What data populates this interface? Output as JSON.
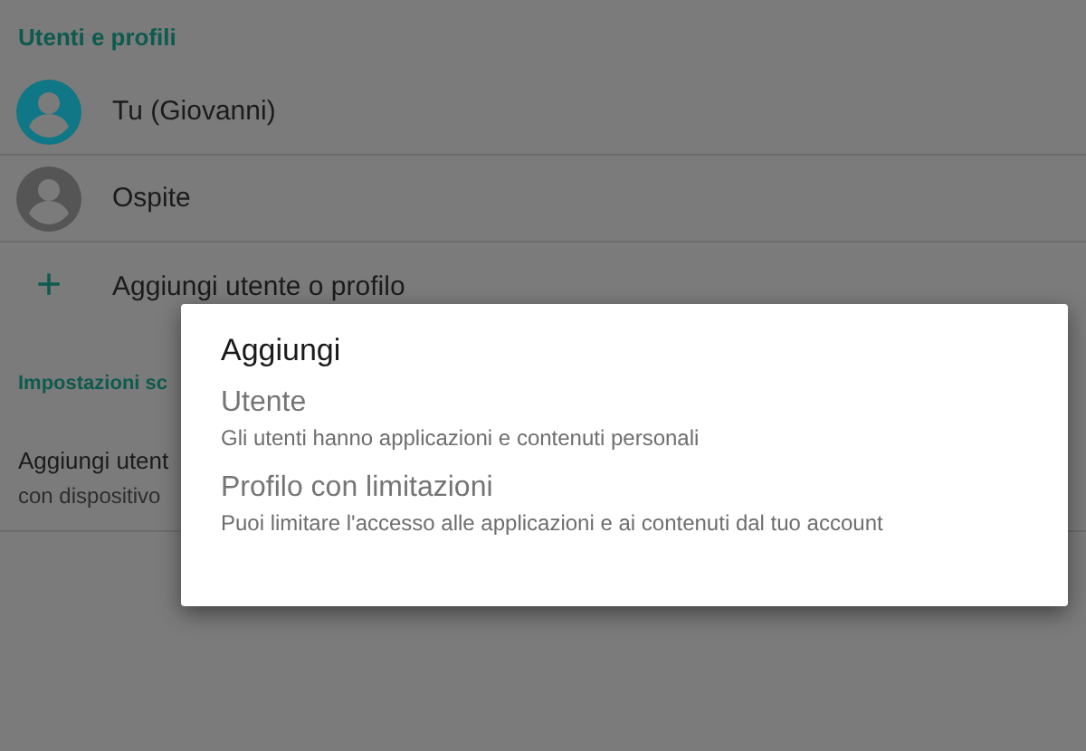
{
  "sections": [
    {
      "header": "Utenti e profili",
      "items": [
        {
          "kind": "avatar",
          "title": "Tu (Giovanni)",
          "color": "#0f7785"
        },
        {
          "kind": "avatar",
          "title": "Ospite",
          "color": "#555555"
        },
        {
          "kind": "add",
          "icon": "+",
          "title": "Aggiungi utente o profilo"
        }
      ]
    },
    {
      "header": "Impostazioni sc",
      "items": [
        {
          "kind": "setting",
          "title": "Aggiungi utent",
          "subtitle": "con dispositivo"
        }
      ]
    }
  ],
  "dialog": {
    "title": "Aggiungi",
    "options": [
      {
        "title": "Utente",
        "subtitle": "Gli utenti hanno applicazioni e contenuti personali"
      },
      {
        "title": "Profilo con limitazioni",
        "subtitle": "Puoi limitare l'accesso alle applicazioni e ai contenuti dal tuo account"
      }
    ]
  }
}
